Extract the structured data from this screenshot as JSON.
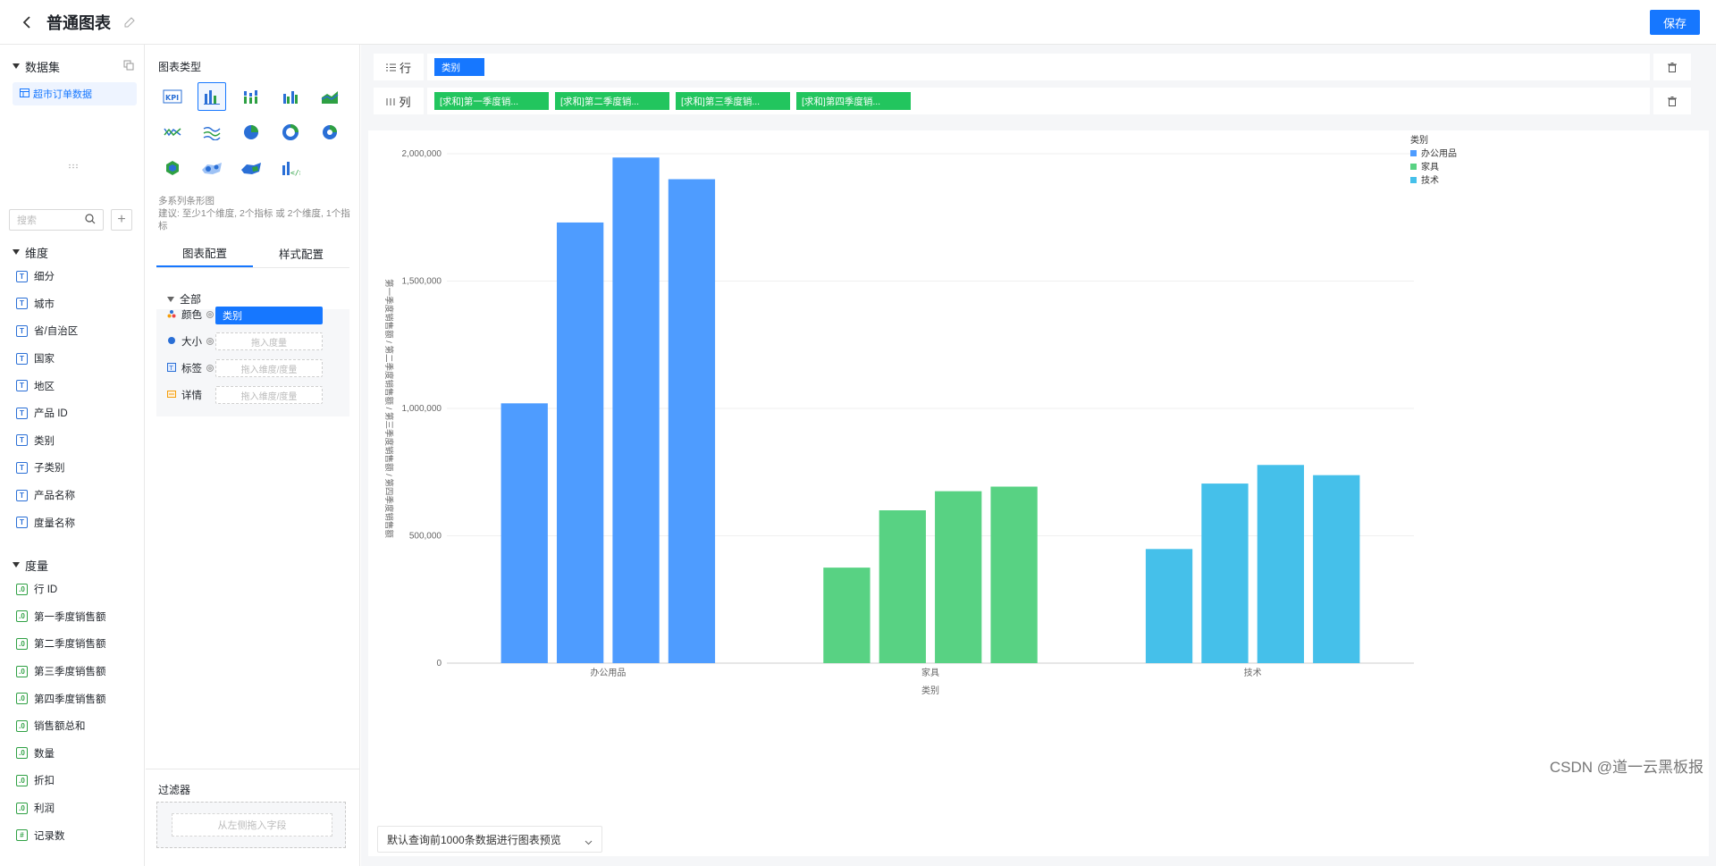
{
  "header": {
    "title": "普通图表",
    "save_label": "保存"
  },
  "left": {
    "dataset_title": "数据集",
    "dataset_item": "超市订单数据",
    "search_placeholder": "搜索",
    "dimensions_title": "维度",
    "dimensions": [
      "细分",
      "城市",
      "省/自治区",
      "国家",
      "地区",
      "产品 ID",
      "类别",
      "子类别",
      "产品名称",
      "度量名称"
    ],
    "measures_title": "度量",
    "measures": [
      "行 ID",
      "第一季度销售额",
      "第二季度销售额",
      "第三季度销售额",
      "第四季度销售额",
      "销售额总和",
      "数量",
      "折扣",
      "利润",
      "记录数"
    ]
  },
  "mid": {
    "chart_types_label": "图表类型",
    "selected_type_name": "多系列条形图",
    "selected_type_hint": "建议: 至少1个维度, 2个指标 或 2个维度, 1个指标",
    "tabs": [
      "图表配置",
      "样式配置"
    ],
    "all_label": "全部",
    "rows": [
      {
        "label": "颜色",
        "value": "类别"
      },
      {
        "label": "大小",
        "placeholder": "拖入度量"
      },
      {
        "label": "标签",
        "placeholder": "拖入维度/度量"
      },
      {
        "label": "详情",
        "placeholder": "拖入维度/度量"
      }
    ],
    "filter_title": "过滤器",
    "filter_placeholder": "从左侧拖入字段"
  },
  "shelves": {
    "row_label": "行",
    "col_label": "列",
    "row_pills": [
      "类别"
    ],
    "col_pills": [
      "[求和]第一季度销...",
      "[求和]第二季度销...",
      "[求和]第三季度销...",
      "[求和]第四季度销..."
    ]
  },
  "bottom": {
    "preview_select": "默认查询前1000条数据进行图表预览"
  },
  "watermark": "CSDN @道一云黑板报",
  "colors": {
    "accent": "#1677ff",
    "office": "#4e9cff",
    "furniture": "#58d283",
    "tech": "#45c0ea"
  },
  "chart_data": {
    "type": "bar",
    "categories": [
      "办公用品",
      "家具",
      "技术"
    ],
    "series": [
      {
        "values": [
          1020000,
          375000,
          448000
        ]
      },
      {
        "values": [
          1730000,
          600000,
          705000
        ]
      },
      {
        "values": [
          1985000,
          675000,
          778000
        ]
      },
      {
        "values": [
          1900000,
          693000,
          738000
        ]
      }
    ],
    "xlabel": "类别",
    "ylabel": "第一季度销售额 / 第二季度销售额 / 第三季度销售额 / 第四季度销售额",
    "ylim": [
      0,
      2000000
    ],
    "yticks": [
      "0",
      "500,000",
      "1,000,000",
      "1,500,000",
      "2,000,000"
    ],
    "legend_title": "类别",
    "legend": [
      "办公用品",
      "家具",
      "技术"
    ],
    "legend_position": "top-right",
    "grid": true
  }
}
